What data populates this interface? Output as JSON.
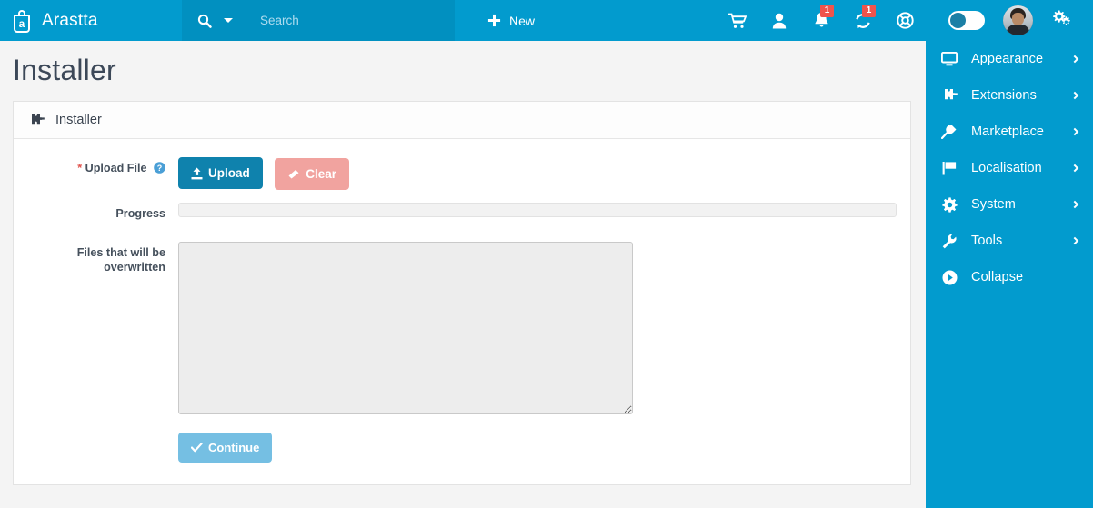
{
  "brand": {
    "name": "Arastta",
    "logo_icon": "shopping-bag-logo"
  },
  "search": {
    "placeholder": "Search",
    "value": "",
    "icon": "search-icon",
    "dropdown_icon": "caret-down-icon"
  },
  "topbar": {
    "new_label": "New",
    "new_icon": "plus-icon",
    "icons": [
      {
        "name": "cart-icon",
        "badge": ""
      },
      {
        "name": "user-icon",
        "badge": ""
      },
      {
        "name": "bell-icon",
        "badge": "1"
      },
      {
        "name": "sync-icon",
        "badge": "1"
      },
      {
        "name": "lifebuoy-icon",
        "badge": ""
      }
    ],
    "toggle": {
      "name": "dark-mode-toggle",
      "state": "off"
    },
    "avatar": {
      "name": "user-avatar"
    },
    "settings_icon": "cogs-icon"
  },
  "page": {
    "title": "Installer"
  },
  "panel": {
    "header_title": "Installer",
    "header_icon": "puzzle-piece-icon",
    "fields": {
      "upload": {
        "label": "Upload File",
        "required_marker": "*",
        "help_icon": "question-circle-icon",
        "upload_button": "Upload",
        "upload_icon": "upload-icon",
        "clear_button": "Clear",
        "clear_icon": "eraser-icon"
      },
      "progress": {
        "label": "Progress",
        "percent": 0,
        "value_text": ""
      },
      "files": {
        "label": "Files that will be overwritten",
        "value": "",
        "placeholder": ""
      }
    },
    "continue_button": "Continue",
    "continue_icon": "check-icon"
  },
  "sidebar": {
    "items": [
      {
        "label": "Appearance",
        "icon": "desktop-icon",
        "chevron": true
      },
      {
        "label": "Extensions",
        "icon": "puzzle-piece-icon",
        "chevron": true
      },
      {
        "label": "Marketplace",
        "icon": "plug-icon",
        "chevron": true
      },
      {
        "label": "Localisation",
        "icon": "flag-icon",
        "chevron": true
      },
      {
        "label": "System",
        "icon": "gear-icon",
        "chevron": true
      },
      {
        "label": "Tools",
        "icon": "wrench-icon",
        "chevron": true
      },
      {
        "label": "Collapse",
        "icon": "play-circle-icon",
        "chevron": false
      }
    ]
  },
  "colors": {
    "brand_blue": "#029bce",
    "search_blue": "#0190c0",
    "upload_blue": "#0f82ad",
    "clear_pink": "#f1a39f",
    "continue_blue": "#75bfe3",
    "badge_red": "#f0544c",
    "page_bg": "#f4f4f4"
  }
}
